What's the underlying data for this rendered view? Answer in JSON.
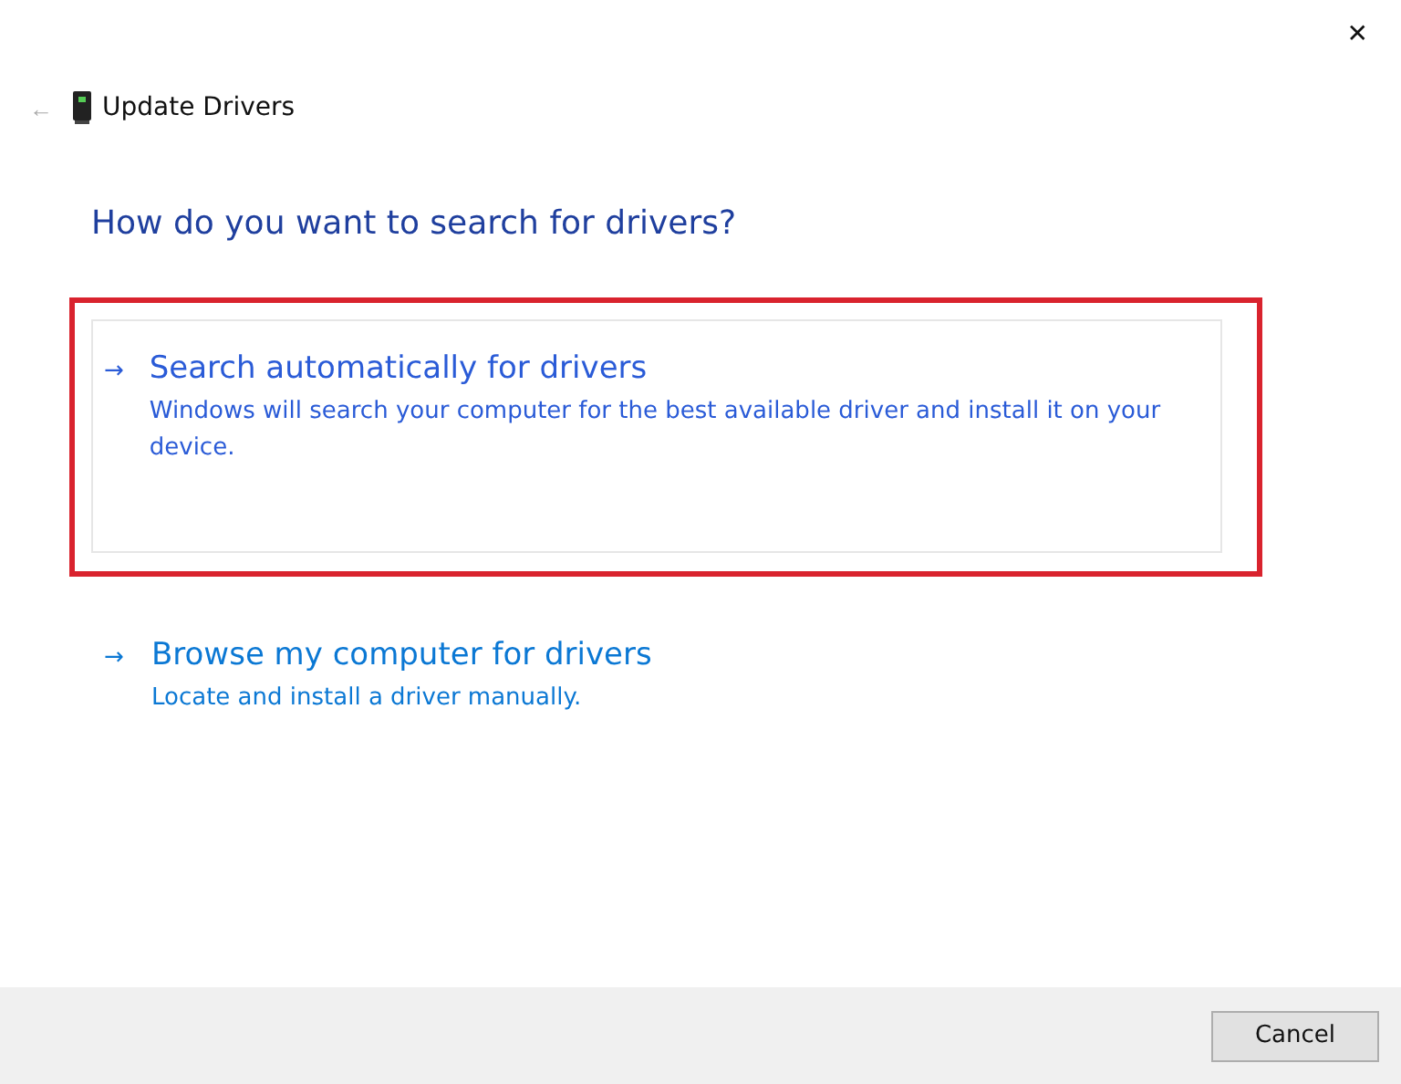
{
  "window": {
    "title": "Update Drivers",
    "close": "✕",
    "back": "←"
  },
  "heading": "How do you want to search for drivers?",
  "options": [
    {
      "title": "Search automatically for drivers",
      "description": "Windows will search your computer for the best available driver and install it on your device.",
      "arrow": "→",
      "selected": true,
      "highlighted": true
    },
    {
      "title": "Browse my computer for drivers",
      "description": "Locate and install a driver manually.",
      "arrow": "→",
      "selected": false,
      "highlighted": false
    }
  ],
  "buttons": [
    {
      "label": "Cancel"
    }
  ]
}
